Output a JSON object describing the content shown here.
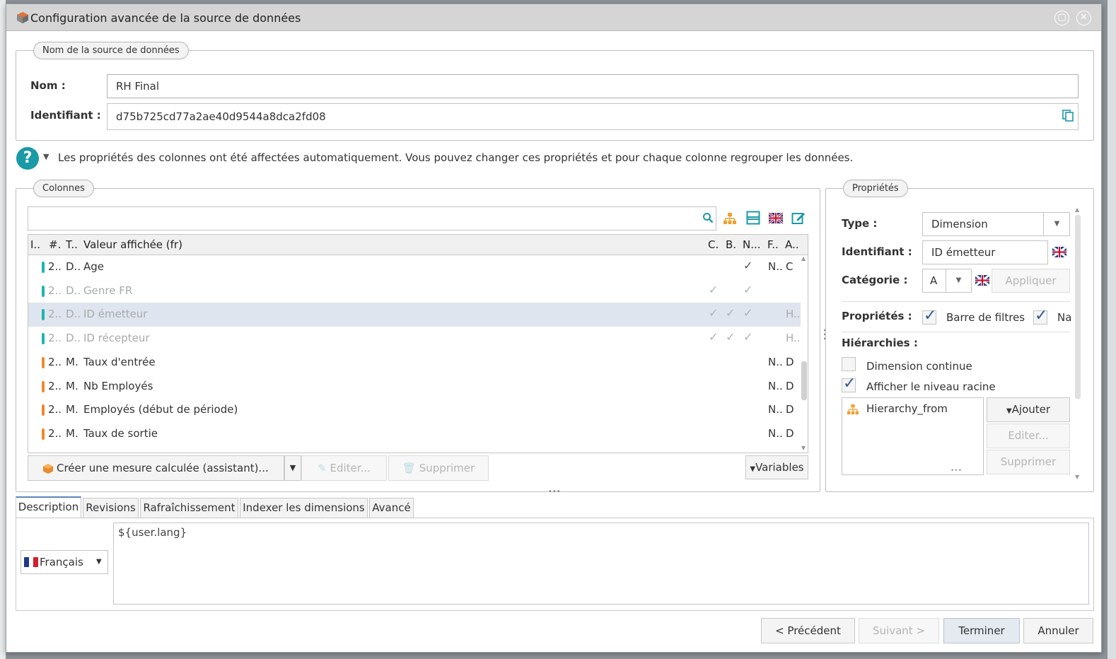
{
  "window": {
    "title": "Configuration avancée de la source de données"
  },
  "datasource": {
    "legend": "Nom de la source de données",
    "name_label": "Nom :",
    "name_value": "RH Final",
    "id_label": "Identifiant :",
    "id_value": "d75b725cd77a2ae40d9544a8dca2fd08"
  },
  "info_text": "Les propriétés des colonnes ont été affectées automatiquement. Vous pouvez changer ces propriétés et pour chaque colonne regrouper les données.",
  "columns": {
    "legend": "Colonnes",
    "headers": {
      "i": "I..",
      "num": "#.",
      "type": "T..",
      "label": "Valeur affichée (fr)",
      "c": "C.",
      "b": "B.",
      "n": "N...",
      "f": "F..",
      "a": "A.."
    },
    "rows": [
      {
        "i": "2..",
        "type": "D..",
        "label": "Age",
        "c": "",
        "b": "",
        "n": "✓",
        "f": "N..",
        "a": "C",
        "color": "#1fb5b0",
        "state": ""
      },
      {
        "i": "2..",
        "type": "D..",
        "label": "Genre FR",
        "c": "✓",
        "b": "",
        "n": "✓",
        "f": "",
        "a": "",
        "color": "#1fb5b0",
        "state": "dim"
      },
      {
        "i": "2..",
        "type": "D..",
        "label": "ID émetteur",
        "c": "✓",
        "b": "✓",
        "n": "✓",
        "f": "",
        "a": "H..",
        "color": "#1fb5b0",
        "state": "dim sel"
      },
      {
        "i": "2..",
        "type": "D..",
        "label": "ID récepteur",
        "c": "✓",
        "b": "✓",
        "n": "✓",
        "f": "",
        "a": "H..",
        "color": "#1fb5b0",
        "state": "dim"
      },
      {
        "i": "2..",
        "type": "M.",
        "label": "Taux d'entrée",
        "c": "",
        "b": "",
        "n": "",
        "f": "N..",
        "a": "D",
        "color": "#f0892e",
        "state": ""
      },
      {
        "i": "2..",
        "type": "M.",
        "label": "Nb Employés",
        "c": "",
        "b": "",
        "n": "",
        "f": "N..",
        "a": "D",
        "color": "#f0892e",
        "state": ""
      },
      {
        "i": "2..",
        "type": "M.",
        "label": "Employés (début de période)",
        "c": "",
        "b": "",
        "n": "",
        "f": "N..",
        "a": "D",
        "color": "#f0892e",
        "state": ""
      },
      {
        "i": "2..",
        "type": "M.",
        "label": "Taux de sortie",
        "c": "",
        "b": "",
        "n": "",
        "f": "N..",
        "a": "D",
        "color": "#f0892e",
        "state": ""
      }
    ],
    "create_button": "Créer une mesure calculée (assistant)...",
    "edit_button": "Editer...",
    "delete_button": "Supprimer",
    "variables_button": "Variables"
  },
  "properties": {
    "legend": "Propriétés",
    "type_label": "Type :",
    "type_value": "Dimension",
    "id_label": "Identifiant :",
    "id_value": "ID émetteur",
    "category_label": "Catégorie :",
    "category_value": "A",
    "apply_button": "Appliquer",
    "props_label": "Propriétés :",
    "filter_bar": "Barre de filtres",
    "na": "Na",
    "hier_label": "Hiérarchies :",
    "continuous": "Dimension continue",
    "show_root": "Afficher le niveau racine",
    "hierarchy_item": "Hierarchy_from",
    "add_button": "Ajouter",
    "edit_button": "Editer...",
    "delete_button": "Supprimer"
  },
  "tabs": [
    "Description",
    "Revisions",
    "Rafraîchissement",
    "Indexer les dimensions",
    "Avancé"
  ],
  "description": {
    "language": "Français",
    "text": "${user.lang}"
  },
  "footer": {
    "prev": "< Précédent",
    "next": "Suivant >",
    "finish": "Terminer",
    "cancel": "Annuler"
  },
  "colors": {
    "accent": "#1a9aa6",
    "teal_bar": "#1fb5b0",
    "orange_bar": "#f0892e",
    "titlebar": "#d5d5d5"
  }
}
